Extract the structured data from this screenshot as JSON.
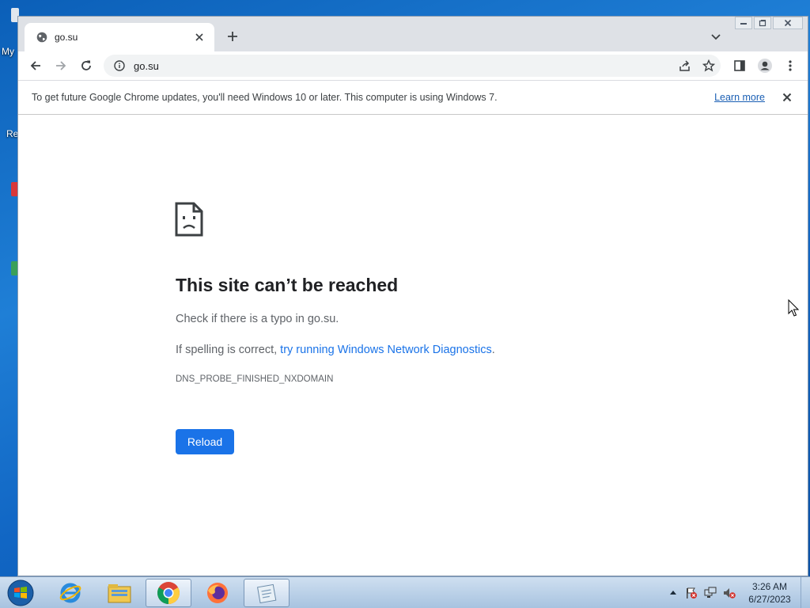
{
  "desktop": {
    "fragments": [
      "My",
      "Re"
    ]
  },
  "browser": {
    "tab": {
      "title": "go.su",
      "favicon": "globe-icon"
    },
    "toolbar": {
      "url": "go.su"
    },
    "infobar": {
      "message": "To get future Google Chrome updates, you'll need Windows 10 or later. This computer is using Windows 7.",
      "link": "Learn more"
    },
    "error": {
      "title": "This site can’t be reached",
      "line1": "Check if there is a typo in go.su.",
      "line2_prefix": "If spelling is correct, ",
      "line2_link": "try running Windows Network Diagnostics",
      "line2_suffix": ".",
      "code": "DNS_PROBE_FINISHED_NXDOMAIN",
      "reload_label": "Reload"
    }
  },
  "taskbar": {
    "apps": [
      "internet-explorer",
      "windows-explorer",
      "google-chrome",
      "firefox",
      "notepad"
    ],
    "clock": {
      "time": "3:26 AM",
      "date": "6/27/2023"
    }
  },
  "colors": {
    "accent": "#1a73e8",
    "link": "#1a5fb4",
    "tabstrip": "#dee1e6"
  }
}
